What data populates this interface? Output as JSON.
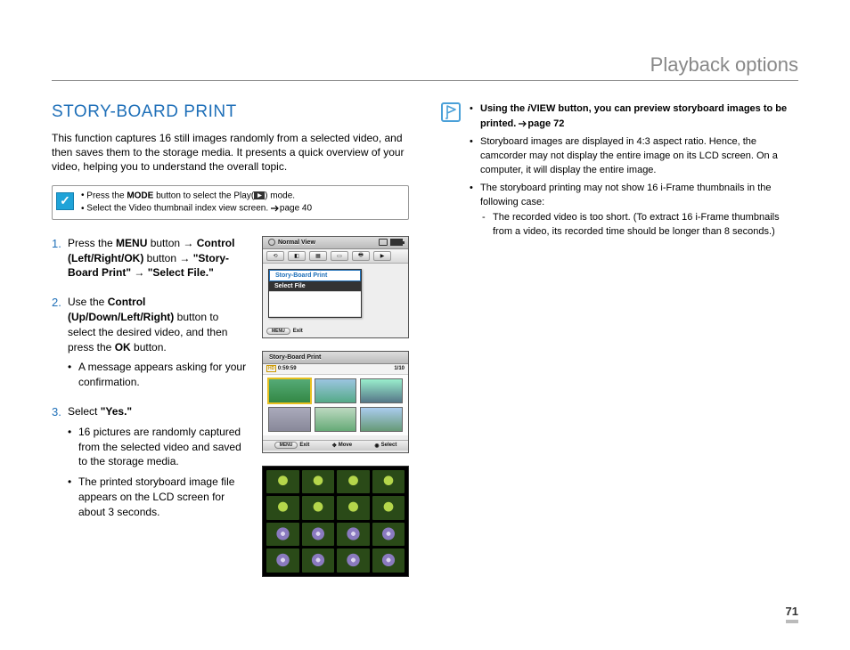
{
  "header": {
    "title": "Playback options"
  },
  "section": {
    "title": "STORY-BOARD PRINT",
    "intro": "This function captures 16 still images randomly from a selected video, and then saves them to the storage media. It presents a quick overview of your video, helping you to understand the overall topic."
  },
  "prereq": {
    "items": [
      {
        "pre": "Press the ",
        "bold": "MODE",
        "post": " button to select the Play(",
        "post2": ") mode."
      },
      {
        "text": "Select the Video thumbnail index view screen. ",
        "page_ref": "page 40"
      }
    ]
  },
  "steps": [
    {
      "parts": [
        "Press the ",
        "MENU",
        " button → ",
        "Control (Left/Right/OK)",
        " button → ",
        "\"Story-Board Print\"",
        " → ",
        "\"Select File.\""
      ],
      "bold_idx": [
        1,
        3,
        5,
        7
      ]
    },
    {
      "parts": [
        "Use the ",
        "Control (Up/Down/Left/Right)",
        " button to select the desired video, and then press the ",
        "OK",
        " button."
      ],
      "bold_idx": [
        1,
        3
      ],
      "sub": [
        "A message appears asking for your confirmation."
      ]
    },
    {
      "parts": [
        "Select ",
        "\"Yes.\""
      ],
      "bold_idx": [
        1
      ],
      "sub": [
        "16 pictures are randomly captured from the selected video and saved to the storage media.",
        "The printed storyboard image file appears on the LCD screen for about 3 seconds."
      ]
    }
  ],
  "shot1": {
    "title": "Normal View",
    "menu_hl": "Story-Board Print",
    "menu_sel": "Select File",
    "exit_label": "Exit",
    "menu_pill": "MENU"
  },
  "shot2": {
    "title": "Story-Board Print",
    "duration": "0:59:59",
    "counter": "1/10",
    "foot": {
      "exit": "Exit",
      "move": "Move",
      "select": "Select",
      "menu_pill": "MENU"
    }
  },
  "info": {
    "items": [
      {
        "bold_pre": "Using the ",
        "bold_i": "i",
        "bold_mid": "VIEW button, you can preview storyboard images to be printed. ",
        "page_ref": "page 72"
      },
      {
        "text": "Storyboard images are displayed in 4:3 aspect ratio. Hence, the camcorder may not display the entire image on its LCD screen. On a computer, it will display the entire image."
      },
      {
        "text": "The storyboard printing may not show 16 i-Frame thumbnails in the following case:",
        "sub": [
          "The recorded video is too short. (To extract 16 i-Frame thumbnails from a video, its recorded time should be longer than 8 seconds.)"
        ]
      }
    ]
  },
  "page_number": "71"
}
